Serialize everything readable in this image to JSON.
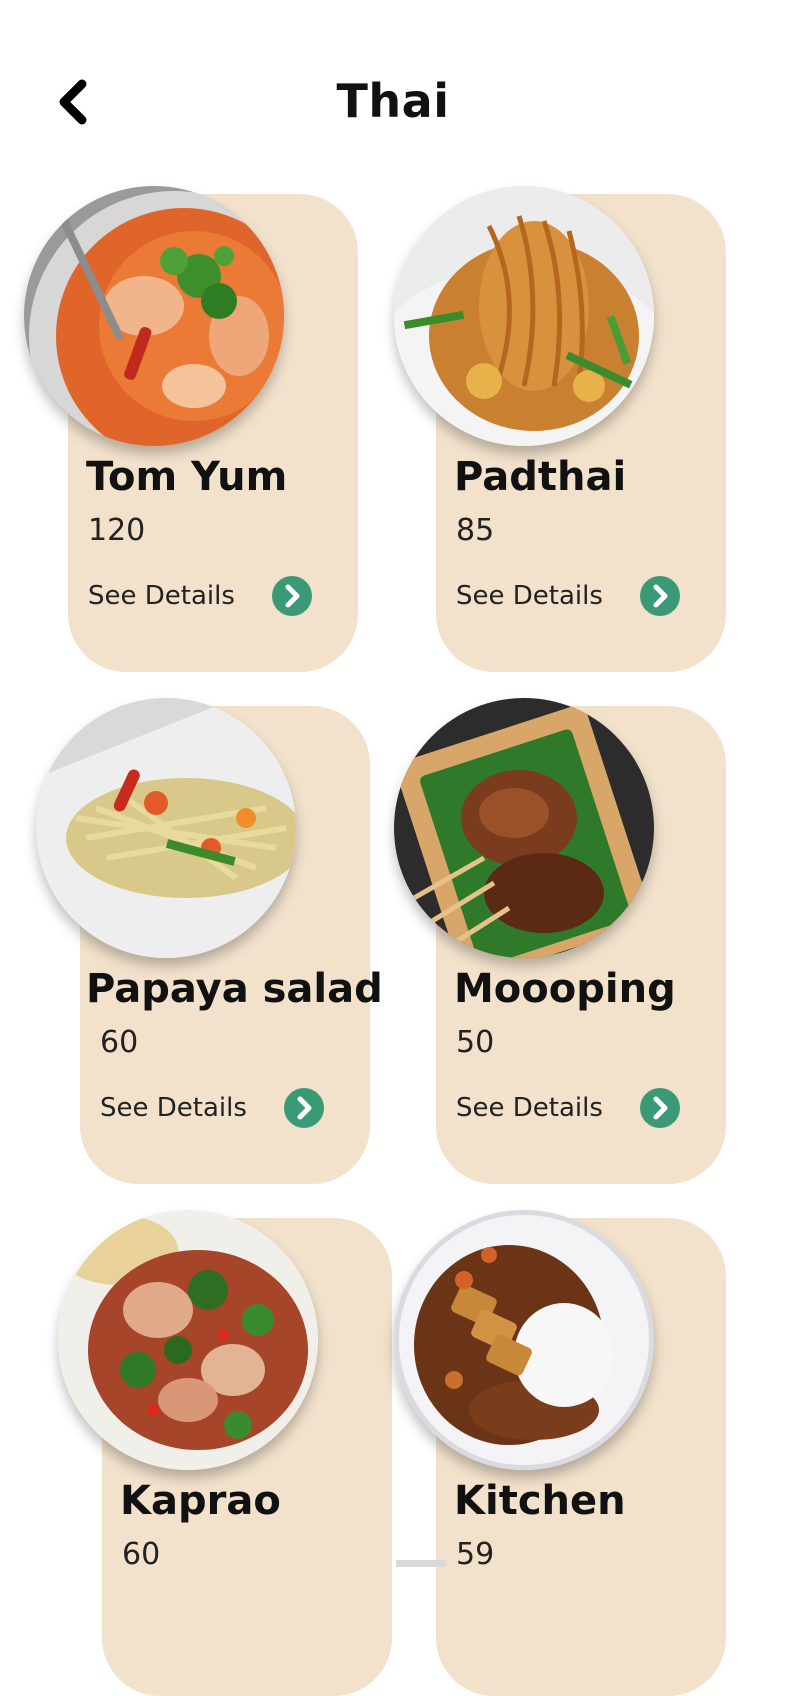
{
  "header": {
    "title": "Thai",
    "back_icon": "chevron-left-icon"
  },
  "accent_color": "#3a9a76",
  "card_color": "#f2e2cc",
  "foods": [
    {
      "name": "Tom Yum",
      "price": "120",
      "details_label": "See Details",
      "details_icon": "chevron-right-icon"
    },
    {
      "name": "Padthai",
      "price": "85",
      "details_label": "See Details",
      "details_icon": "chevron-right-icon"
    },
    {
      "name": "Papaya salad",
      "price": "60",
      "details_label": "See Details",
      "details_icon": "chevron-right-icon"
    },
    {
      "name": "Moooping",
      "price": "50",
      "details_label": "See Details",
      "details_icon": "chevron-right-icon"
    },
    {
      "name": "Kaprao",
      "price": "60"
    },
    {
      "name": "Kitchen",
      "price": "59"
    }
  ]
}
